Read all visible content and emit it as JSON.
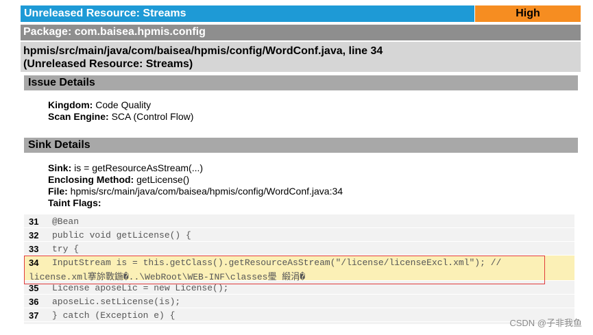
{
  "header": {
    "title": "Unreleased Resource: Streams",
    "severity": "High",
    "package": "Package: com.baisea.hpmis.config",
    "location_line1": "hpmis/src/main/java/com/baisea/hpmis/config/WordConf.java, line 34",
    "location_line2": "(Unreleased Resource: Streams)"
  },
  "issue": {
    "header": "Issue Details",
    "kingdom_label": "Kingdom:",
    "kingdom_value": "Code Quality",
    "engine_label": "Scan Engine:",
    "engine_value": "SCA (Control Flow)"
  },
  "sink": {
    "header": "Sink Details",
    "sink_label": "Sink:",
    "sink_value": "is = getResourceAsStream(...)",
    "method_label": "Enclosing Method:",
    "method_value": "getLicense()",
    "file_label": "File:",
    "file_value": "hpmis/src/main/java/com/baisea/hpmis/config/WordConf.java:34",
    "taint_label": "Taint Flags:"
  },
  "code": [
    {
      "line": "31",
      "text": "@Bean"
    },
    {
      "line": "32",
      "text": "public void getLicense() {"
    },
    {
      "line": "33",
      "text": "try {"
    },
    {
      "line": "34",
      "text": "InputStream is = this.getClass().getResourceAsStream(\"/license/licenseExcl.xml\"); //",
      "text2": "license.xml搴旀斁鍦�..\\WebRoot\\WEB-INF\\classes璺 緞涓�"
    },
    {
      "line": "35",
      "text": "License aposeLic = new License();"
    },
    {
      "line": "36",
      "text": "aposeLic.setLicense(is);"
    },
    {
      "line": "37",
      "text": "} catch (Exception e) {"
    }
  ],
  "watermark": "CSDN @子非我鱼",
  "colors": {
    "title_bg": "#1e9ad6",
    "severity_bg": "#f68d21",
    "package_bg": "#8e8e8e",
    "highlight_bg": "#fbf0b6",
    "highlight_border": "#e03a3a"
  }
}
